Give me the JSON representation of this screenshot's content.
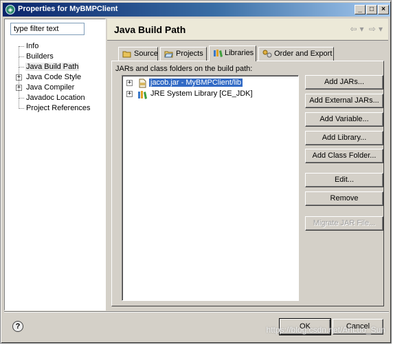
{
  "window": {
    "title": "Properties for MyBMPClient"
  },
  "filter": {
    "value": "type filter text"
  },
  "tree": {
    "items": [
      {
        "label": "Info",
        "expandable": false
      },
      {
        "label": "Builders",
        "expandable": false
      },
      {
        "label": "Java Build Path",
        "expandable": false,
        "selected": true
      },
      {
        "label": "Java Code Style",
        "expandable": true
      },
      {
        "label": "Java Compiler",
        "expandable": true
      },
      {
        "label": "Javadoc Location",
        "expandable": false
      },
      {
        "label": "Project References",
        "expandable": false
      }
    ]
  },
  "header": {
    "title": "Java Build Path",
    "back_glyph": "⇦",
    "forward_glyph": "⇨",
    "menu_glyph": "▾"
  },
  "tabs": [
    {
      "label": "Source",
      "icon": "source-folder-icon"
    },
    {
      "label": "Projects",
      "icon": "projects-icon"
    },
    {
      "label": "Libraries",
      "icon": "libraries-icon",
      "active": true
    },
    {
      "label": "Order and Export",
      "icon": "order-export-icon"
    }
  ],
  "libraries": {
    "caption": "JARs and class folders on the build path:",
    "entries": [
      {
        "label": "jacob.jar - MyBMPClient/lib",
        "icon": "jar-icon",
        "selected": true
      },
      {
        "label": "JRE System Library [CE_JDK]",
        "icon": "jre-library-icon",
        "selected": false
      }
    ]
  },
  "buttons": {
    "add_jars": "Add JARs...",
    "add_external_jars": "Add External JARs...",
    "add_variable": "Add Variable...",
    "add_library": "Add Library...",
    "add_class_folder": "Add Class Folder...",
    "edit": "Edit...",
    "remove": "Remove",
    "migrate_jar": "Migrate JAR File..."
  },
  "dialog": {
    "ok": "OK",
    "cancel": "Cancel",
    "help_glyph": "?"
  },
  "watermark": "https://blog.csdn.net/AnLuo_Sun",
  "colors": {
    "title_bar": "#0a246a",
    "selection": "#316ac5",
    "face": "#d4d0c8"
  }
}
